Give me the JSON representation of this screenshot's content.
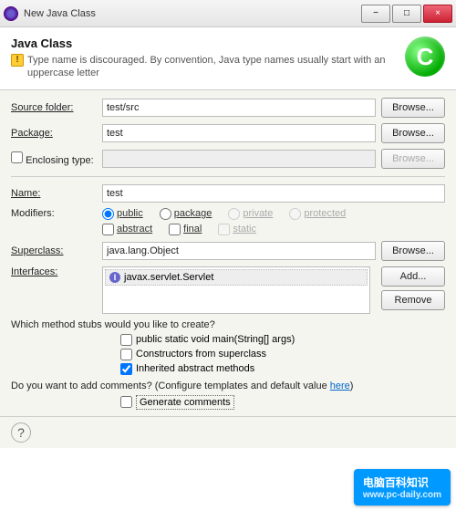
{
  "window": {
    "title": "New Java Class",
    "minimize": "−",
    "maximize": "□",
    "close": "×"
  },
  "header": {
    "title": "Java Class",
    "warning": "Type name is discouraged. By convention, Java type names usually start with an uppercase letter",
    "icon_letter": "C"
  },
  "sourceFolder": {
    "label": "Source folder:",
    "value": "test/src",
    "button": "Browse..."
  },
  "package": {
    "label": "Package:",
    "value": "test",
    "button": "Browse..."
  },
  "enclosing": {
    "checkbox": "Enclosing type:",
    "value": "",
    "button": "Browse..."
  },
  "name": {
    "label": "Name:",
    "value": "test"
  },
  "modifiers": {
    "label": "Modifiers:",
    "public": "public",
    "package": "package",
    "private": "private",
    "protected": "protected",
    "abstract": "abstract",
    "final": "final",
    "static": "static"
  },
  "superclass": {
    "label": "Superclass:",
    "value": "java.lang.Object",
    "button": "Browse..."
  },
  "interfaces": {
    "label": "Interfaces:",
    "item": "javax.servlet.Servlet",
    "add": "Add...",
    "remove": "Remove"
  },
  "stubsQuestion": "Which method stubs would you like to create?",
  "stubs": {
    "main": "public static void main(String[] args)",
    "constructors": "Constructors from superclass",
    "inherited": "Inherited abstract methods"
  },
  "commentsQuestion": {
    "prefix": "Do you want to add comments? (Configure templates and default value ",
    "link": "here",
    "suffix": ")"
  },
  "generateComments": "Generate comments",
  "help": "?",
  "watermark": {
    "brand": "电脑百科知识",
    "url": "www.pc-daily.com"
  }
}
